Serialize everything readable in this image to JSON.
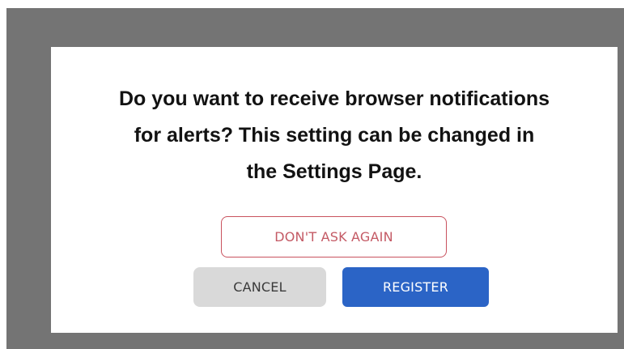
{
  "dialog": {
    "message_lines": [
      "Do you want to receive browser notifications",
      "for alerts? This setting can be changed in",
      "the Settings Page."
    ],
    "dont_ask_label": "DON'T ASK AGAIN",
    "cancel_label": "CANCEL",
    "register_label": "REGISTER"
  },
  "colors": {
    "overlay": "#747474",
    "dont_ask_border": "#c9525e",
    "register_bg": "#2b64c6",
    "cancel_bg": "#d9d9d9"
  }
}
